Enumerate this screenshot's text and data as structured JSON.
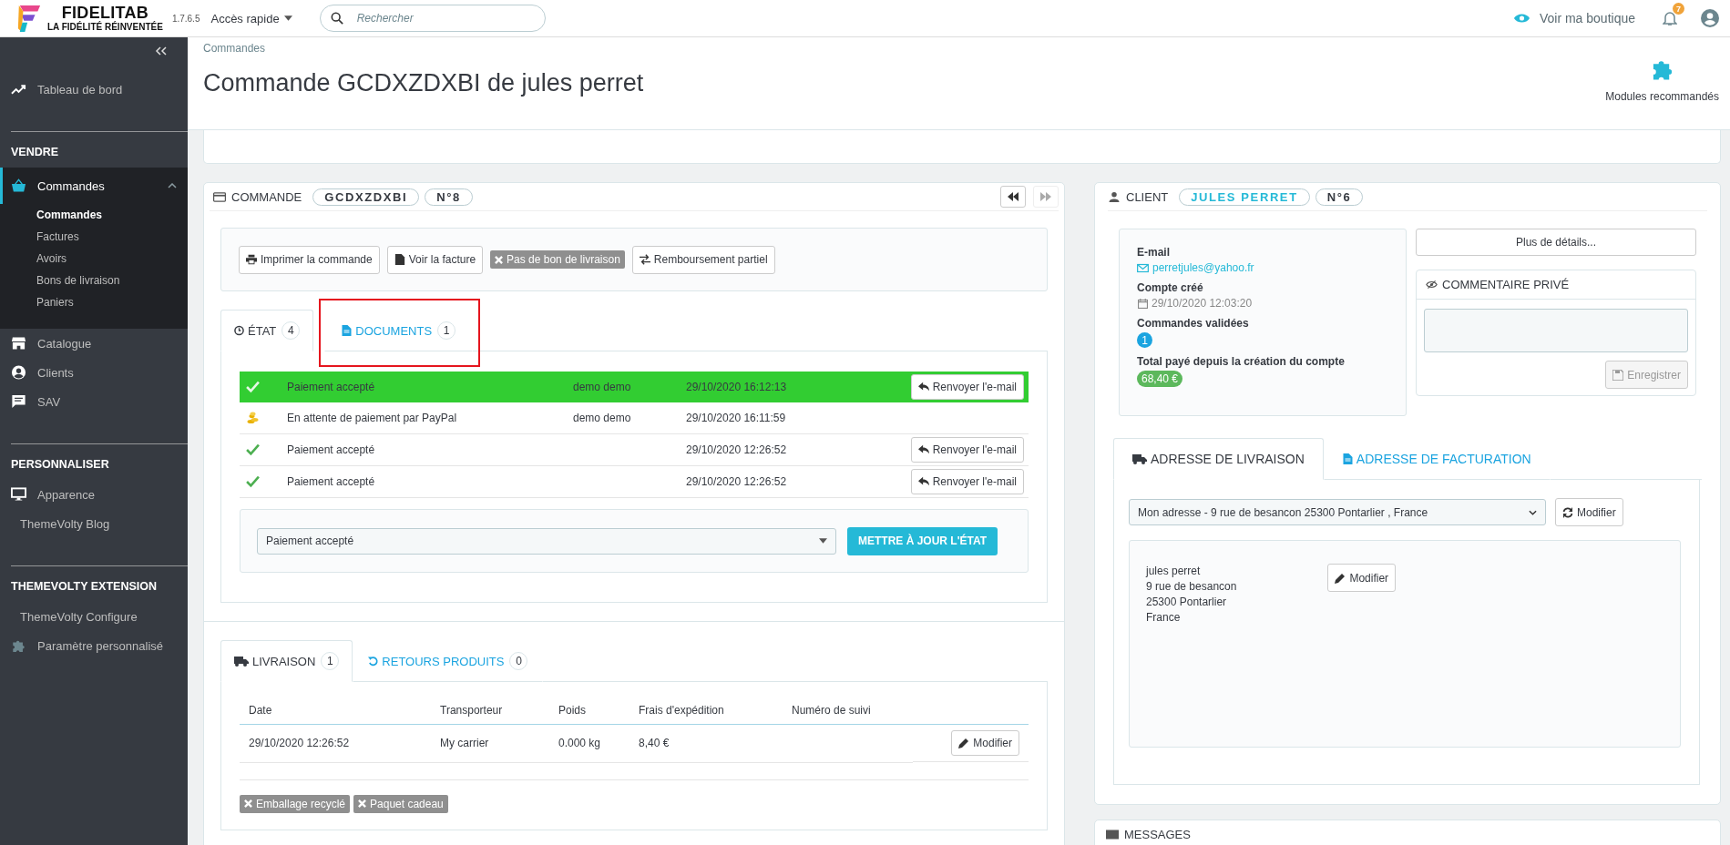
{
  "header": {
    "logo_title": "FIDELITAB",
    "logo_subtitle": "LA FIDÉLITÉ RÉINVENTÉE",
    "version": "1.7.6.5",
    "quick_access": "Accès rapide",
    "search": {
      "placeholder": "Rechercher"
    },
    "view_shop": "Voir ma boutique",
    "notifications": "7"
  },
  "sidebar": {
    "sections": [
      {
        "items": [
          {
            "label": "Tableau de bord",
            "kind": "trend",
            "selected": false
          }
        ]
      },
      {
        "title": "VENDRE",
        "items": [
          {
            "label": "Commandes",
            "kind": "basket",
            "selected": true,
            "children": [
              {
                "label": "Commandes",
                "selected": true
              },
              {
                "label": "Factures",
                "selected": false
              },
              {
                "label": "Avoirs",
                "selected": false
              },
              {
                "label": "Bons de livraison",
                "selected": false
              },
              {
                "label": "Paniers",
                "selected": false
              }
            ]
          },
          {
            "label": "Catalogue",
            "kind": "store",
            "selected": false
          },
          {
            "label": "Clients",
            "kind": "user",
            "selected": false
          },
          {
            "label": "SAV",
            "kind": "chat",
            "selected": false
          }
        ]
      },
      {
        "title": "PERSONNALISER",
        "items": [
          {
            "label": "Apparence",
            "kind": "monitor",
            "selected": false
          },
          {
            "label": "ThemeVolty Blog",
            "kind": "plain",
            "selected": false
          }
        ]
      },
      {
        "title": "THEMEVOLTY EXTENSION",
        "items": [
          {
            "label": "ThemeVolty Configure",
            "kind": "plain",
            "selected": false
          },
          {
            "label": "Paramètre personnalisé",
            "kind": "puzzle",
            "selected": false
          }
        ]
      }
    ]
  },
  "page": {
    "breadcrumb": "Commandes",
    "title": "Commande GCDXZDXBI de jules perret",
    "toolbar_button": "Modules recommandés"
  },
  "order": {
    "title": "COMMANDE",
    "reference": "GCDXZDXBI",
    "number": "N°8",
    "actions": [
      {
        "label": "Imprimer la commande",
        "kind": "print"
      },
      {
        "label": "Voir la facture",
        "kind": "file"
      },
      {
        "label": "Pas de bon de livraison",
        "kind": "tag"
      },
      {
        "label": "Remboursement partiel",
        "kind": "exchange"
      }
    ],
    "tabs": [
      {
        "label": "ÉTAT",
        "count": "4",
        "kind": "clock",
        "selected": true,
        "highlighted": false
      },
      {
        "label": "DOCUMENTS",
        "count": "1",
        "kind": "file",
        "selected": false,
        "highlighted": true
      }
    ],
    "history": [
      {
        "status": "Paiement accepté",
        "kind": "check",
        "employee": "demo demo",
        "date": "29/10/2020 16:12:13",
        "resend": "Renvoyer l'e-mail",
        "selected": true
      },
      {
        "status": "En attente de paiement par PayPal",
        "kind": "coins",
        "employee": "demo demo",
        "date": "29/10/2020 16:11:59",
        "selected": false
      },
      {
        "status": "Paiement accepté",
        "kind": "check",
        "date": "29/10/2020 12:26:52",
        "resend": "Renvoyer l'e-mail",
        "selected": false
      },
      {
        "status": "Paiement accepté",
        "kind": "check",
        "date": "29/10/2020 12:26:52",
        "resend": "Renvoyer l'e-mail",
        "selected": false
      }
    ],
    "state_select": "Paiement accepté",
    "update_button": "METTRE À JOUR L'ÉTAT",
    "shipping_tabs": [
      {
        "label": "LIVRAISON",
        "count": "1",
        "kind": "truck",
        "selected": true
      },
      {
        "label": "RETOURS PRODUITS",
        "count": "0",
        "kind": "undo",
        "selected": false
      }
    ],
    "shipping_table": {
      "columns": [
        "Date",
        "Transporteur",
        "Poids",
        "Frais d'expédition",
        "Numéro de suivi"
      ],
      "rows": [
        {
          "cells": [
            "29/10/2020 12:26:52",
            "My carrier",
            "0.000 kg",
            "8,40 €",
            ""
          ],
          "button": "Modifier"
        }
      ]
    },
    "options": [
      "Emballage recyclé",
      "Paquet cadeau"
    ]
  },
  "customer": {
    "title": "CLIENT",
    "name": "JULES PERRET",
    "number": "N°6",
    "email_label": "E-mail",
    "email": "perretjules@yahoo.fr",
    "created_label": "Compte créé",
    "created": "29/10/2020 12:03:20",
    "orders_label": "Commandes validées",
    "orders": "1",
    "total_label": "Total payé depuis la création du compte",
    "total": "68,40 €",
    "more_button": "Plus de détails...",
    "comment_title": "COMMENTAIRE PRIVÉ",
    "save_button": {
      "label": "Enregistrer",
      "disabled": true
    },
    "address_tabs": [
      {
        "label": "ADRESSE DE LIVRAISON",
        "kind": "truck",
        "selected": true
      },
      {
        "label": "ADRESSE DE FACTURATION",
        "kind": "file",
        "selected": false
      }
    ],
    "address_select": "Mon adresse - 9 rue de besancon 25300 Pontarlier , France",
    "change_button": "Modifier",
    "address_lines": [
      "jules perret",
      "9 rue de besancon",
      "25300 Pontarlier",
      "France"
    ],
    "edit_button": "Modifier"
  },
  "messages": {
    "title": "MESSAGES"
  }
}
